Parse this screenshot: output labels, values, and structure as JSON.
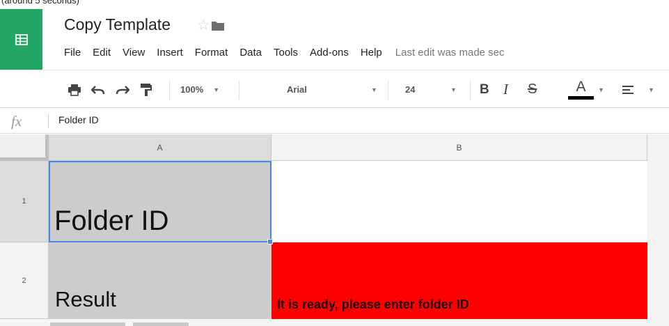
{
  "caption": "(around 5 seconds)",
  "app": {
    "logo_icon": "sheets-grid-icon",
    "brand_color": "#23a566"
  },
  "document": {
    "title": "Copy Template",
    "star_icon": "star-outline-icon",
    "folder_icon": "folder-icon"
  },
  "menu": {
    "items": [
      "File",
      "Edit",
      "View",
      "Insert",
      "Format",
      "Data",
      "Tools",
      "Add-ons",
      "Help"
    ],
    "last_edit": "Last edit was made sec"
  },
  "toolbar": {
    "print_icon": "print-icon",
    "undo_icon": "undo-icon",
    "redo_icon": "redo-icon",
    "paint_format_icon": "paint-format-icon",
    "zoom": "100%",
    "font": "Arial",
    "font_size": "24",
    "bold_label": "B",
    "italic_label": "I",
    "strike_label": "S",
    "text_color_label": "A",
    "align_icon": "align-left-icon"
  },
  "formula_bar": {
    "fx_label": "fx",
    "value": "Folder ID"
  },
  "grid": {
    "columns": [
      "A",
      "B"
    ],
    "rows": [
      "1",
      "2"
    ],
    "cells": {
      "A1": "Folder ID",
      "A2": "Result",
      "B1": "",
      "B2": "It is ready, please enter folder ID"
    },
    "selected_cell": "A1",
    "colors": {
      "selection": "#4a86e8",
      "a_fill": "#cccccc",
      "b2_fill": "#ff0000"
    }
  }
}
